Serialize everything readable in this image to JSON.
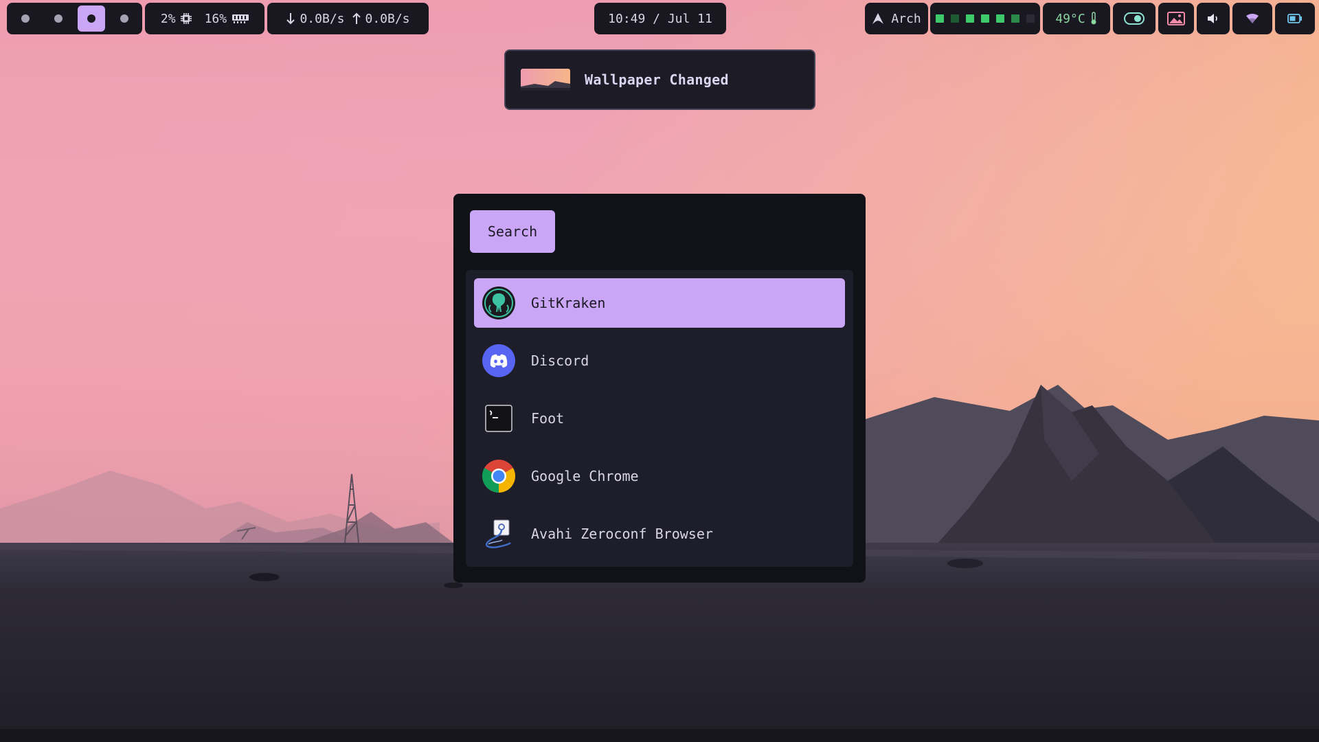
{
  "topbar": {
    "workspaces": [
      {
        "active": false
      },
      {
        "active": false
      },
      {
        "active": true
      },
      {
        "active": false
      }
    ],
    "cpu": "2%",
    "cpu_icon": "cpu-chip-icon",
    "memory": "16%",
    "memory_icon": "ram-icon",
    "net_down": "0.0B/s",
    "net_up": "0.0B/s",
    "clock": "10:49 / Jul 11",
    "distro": "Arch",
    "distro_icon": "arch-logo-icon",
    "temperature": "49°C",
    "temperature_icon": "thermometer-icon",
    "tray_icons": [
      "toggle-icon",
      "wallpaper-icon",
      "volume-icon",
      "wifi-icon",
      "battery-icon"
    ]
  },
  "notification": {
    "title": "Wallpaper Changed"
  },
  "launcher": {
    "search_label": "Search",
    "apps": [
      {
        "name": "GitKraken",
        "icon": "gitkraken-icon",
        "selected": true
      },
      {
        "name": "Discord",
        "icon": "discord-icon",
        "selected": false
      },
      {
        "name": "Foot",
        "icon": "terminal-icon",
        "selected": false
      },
      {
        "name": "Google Chrome",
        "icon": "chrome-icon",
        "selected": false
      },
      {
        "name": "Avahi Zeroconf Browser",
        "icon": "avahi-icon",
        "selected": false
      }
    ]
  },
  "colors": {
    "accent": "#cba6f7",
    "bar_bg": "#191821",
    "green": "#3ec96a",
    "dim_green": "#1e5a33"
  }
}
